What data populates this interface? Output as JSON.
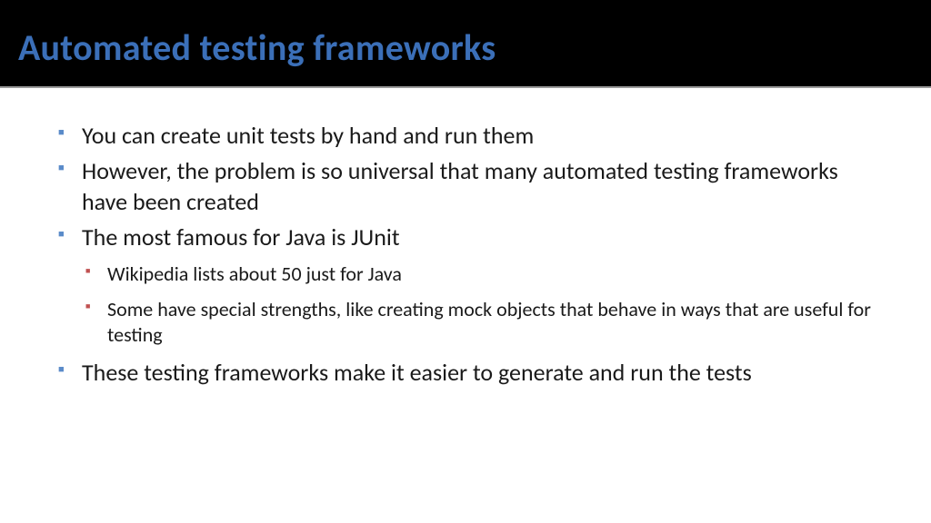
{
  "slide": {
    "title": "Automated testing frameworks",
    "bullets": [
      {
        "text": "You can create unit tests by hand and run them"
      },
      {
        "text": "However, the problem is so universal that many automated testing frameworks have been created"
      },
      {
        "text": "The most famous for Java is JUnit",
        "children": [
          {
            "text": "Wikipedia lists about 50 just for Java"
          },
          {
            "text": "Some have special strengths, like creating mock objects that behave in ways that are useful for testing"
          }
        ]
      },
      {
        "text": "These testing frameworks make it easier to generate and run the tests"
      }
    ]
  }
}
